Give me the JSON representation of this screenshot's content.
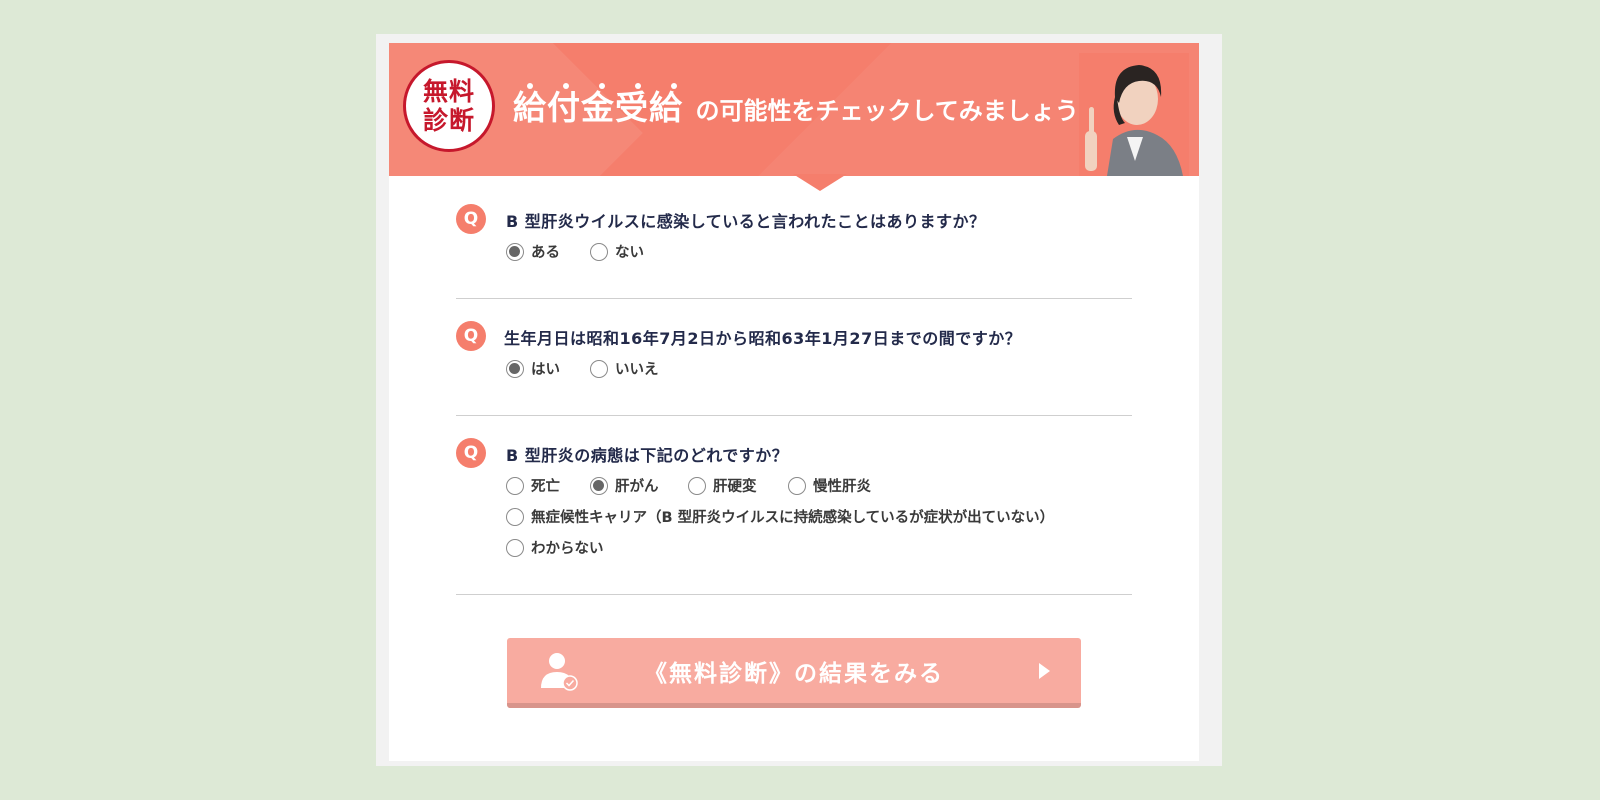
{
  "header": {
    "badge_line1": "無料",
    "badge_line2": "診断",
    "headline_emphasis": "給付金受給",
    "headline_rest": "の可能性をチェックしてみましょう!"
  },
  "questions": [
    {
      "icon": "Q",
      "text": "B 型肝炎ウイルスに感染していると言われたことはありますか？",
      "options": [
        "ある",
        "ない"
      ],
      "selected": "ある"
    },
    {
      "icon": "Q",
      "text": "生年月日は昭和16年7月2日から昭和63年1月27日までの間ですか？",
      "options": [
        "はい",
        "いいえ"
      ],
      "selected": "はい"
    },
    {
      "icon": "Q",
      "text": "B 型肝炎の病態は下記のどれですか？",
      "options": [
        "死亡",
        "肝がん",
        "肝硬変",
        "慢性肝炎",
        "無症候性キャリア（B 型肝炎ウイルスに持続感染しているが症状が出ていない）",
        "わからない"
      ],
      "selected": "肝がん"
    }
  ],
  "submit": {
    "label": "《無料診断》の結果をみる",
    "icon": "user-check-icon",
    "arrow_icon": "play-icon"
  },
  "colors": {
    "accent": "#f57e6c",
    "badge_red": "#c6182c",
    "button": "#f8aba0",
    "background": "#dde9d6"
  }
}
